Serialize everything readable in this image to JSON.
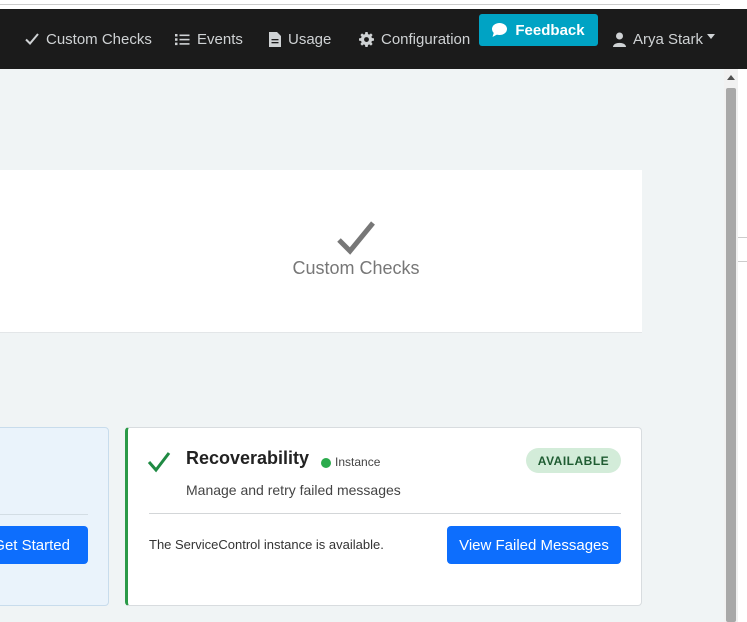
{
  "nav": {
    "custom_checks": "Custom Checks",
    "events": "Events",
    "usage": "Usage",
    "configuration": "Configuration",
    "feedback": "Feedback",
    "user": "Arya Stark"
  },
  "hero": {
    "label": "Custom Checks",
    "icon": "checkmark-icon"
  },
  "left_card": {
    "button_label": "Get Started"
  },
  "recoverability": {
    "title": "Recoverability",
    "instance_label": "Instance",
    "badge": "AVAILABLE",
    "description": "Manage and retry failed messages",
    "status_text": "The ServiceControl instance is available.",
    "button_label": "View Failed Messages"
  },
  "colors": {
    "navbar_bg": "#1b1b1b",
    "feedback_bg": "#00a3c4",
    "primary_button": "#0d6efd",
    "success_green": "#2b9a48",
    "badge_bg": "#d3ecd9"
  }
}
